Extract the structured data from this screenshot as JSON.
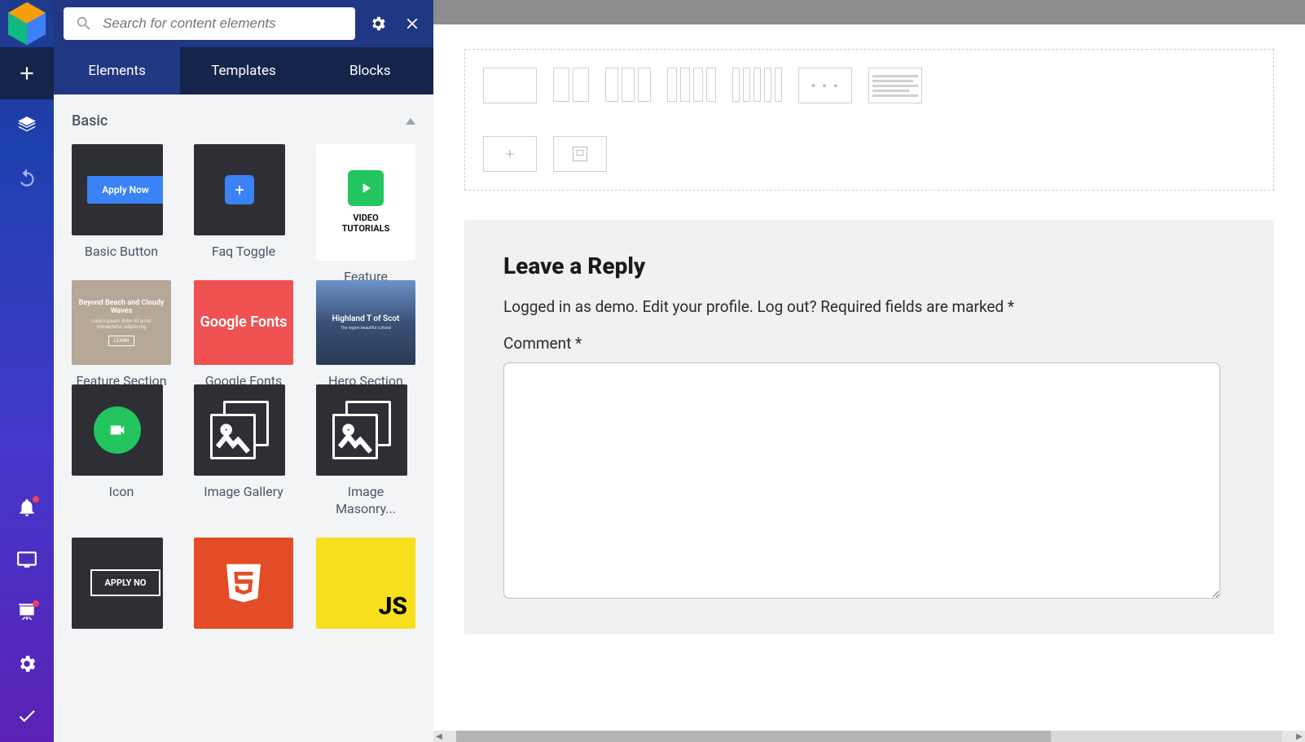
{
  "search": {
    "placeholder": "Search for content elements"
  },
  "tabs": {
    "elements": "Elements",
    "templates": "Templates",
    "blocks": "Blocks"
  },
  "category": {
    "basic": "Basic"
  },
  "elements": {
    "basic_button": {
      "label": "Basic Button",
      "inner": "Apply Now"
    },
    "faq_toggle": {
      "label": "Faq Toggle"
    },
    "feature": {
      "label": "Feature",
      "inner_top": "VIDEO",
      "inner_bottom": "TUTORIALS"
    },
    "feature_section": {
      "label": "Feature Section",
      "inner_title": "Beyond Beach and Cloudy Waves"
    },
    "google_fonts": {
      "label": "Google Fonts Heading",
      "inner": "Google Fonts"
    },
    "hero_section": {
      "label": "Hero Section",
      "inner": "Highland T of Scot"
    },
    "icon": {
      "label": "Icon"
    },
    "image_gallery": {
      "label": "Image Gallery"
    },
    "image_masonry": {
      "label": "Image Masonry..."
    },
    "outline_button": {
      "inner": "APPLY NO"
    },
    "js": {
      "inner": "JS"
    }
  },
  "reply": {
    "title": "Leave a Reply",
    "logged_in": "Logged in as ",
    "user": "demo",
    "sep1": ". ",
    "edit_profile": "Edit your profile",
    "sep2": ". ",
    "logout": "Log out?",
    "required": " Required fields are marked *",
    "comment_label": "Comment *"
  }
}
